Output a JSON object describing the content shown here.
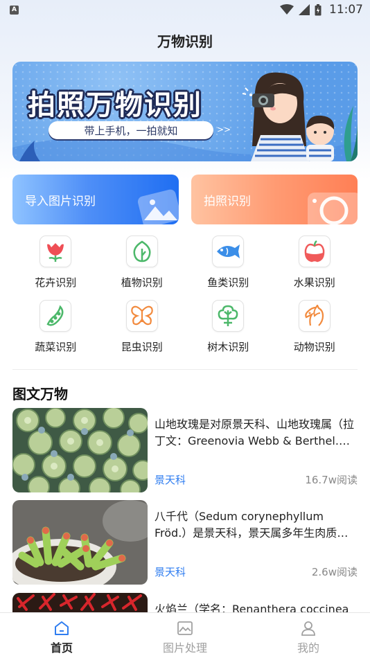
{
  "status_bar": {
    "app_badge": "A",
    "time": "11:07"
  },
  "header": {
    "title": "万物识别"
  },
  "banner": {
    "title": "拍照万物识别",
    "subtitle": "带上手机，一拍就知",
    "arrows": ">>"
  },
  "actions": [
    {
      "label": "导入图片识别",
      "color": "#3f86f5"
    },
    {
      "label": "拍照识别",
      "color": "#ff8f66"
    }
  ],
  "categories": [
    {
      "label": "花卉识别",
      "icon": "flower-icon",
      "color": "#ef4e55"
    },
    {
      "label": "植物识别",
      "icon": "leaf-icon",
      "color": "#4cb86a"
    },
    {
      "label": "鱼类识别",
      "icon": "fish-icon",
      "color": "#3b8ee8"
    },
    {
      "label": "水果识别",
      "icon": "apple-icon",
      "color": "#f05a5a"
    },
    {
      "label": "蔬菜识别",
      "icon": "pea-pod-icon",
      "color": "#4cb86a"
    },
    {
      "label": "昆虫识别",
      "icon": "butterfly-icon",
      "color": "#f28a3d"
    },
    {
      "label": "树木识别",
      "icon": "tree-icon",
      "color": "#4cb86a"
    },
    {
      "label": "动物识别",
      "icon": "horse-icon",
      "color": "#f28a3d"
    }
  ],
  "section": {
    "title": "图文万物"
  },
  "articles": [
    {
      "text": "山地玫瑰是对原景天科、山地玫瑰属（拉丁文：Greenovia Webb & Berthel.）植物的统称",
      "tag": "景天科",
      "reads": "16.7w阅读"
    },
    {
      "text": "八千代（Sedum corynephyllum Fröd.）是景天科，景天属多年生肉质草本植物",
      "tag": "景天科",
      "reads": "2.6w阅读"
    },
    {
      "text": "火焰兰（学名：Renanthera coccinea",
      "tag": "",
      "reads": ""
    }
  ],
  "tab_bar": {
    "tabs": [
      {
        "label": "首页",
        "icon": "home-icon",
        "active": true
      },
      {
        "label": "图片处理",
        "icon": "image-icon",
        "active": false
      },
      {
        "label": "我的",
        "icon": "person-icon",
        "active": false
      }
    ]
  },
  "colors": {
    "accent": "#2f7df0",
    "tab_active": "#222222",
    "tab_inactive": "#a0a0a0"
  }
}
